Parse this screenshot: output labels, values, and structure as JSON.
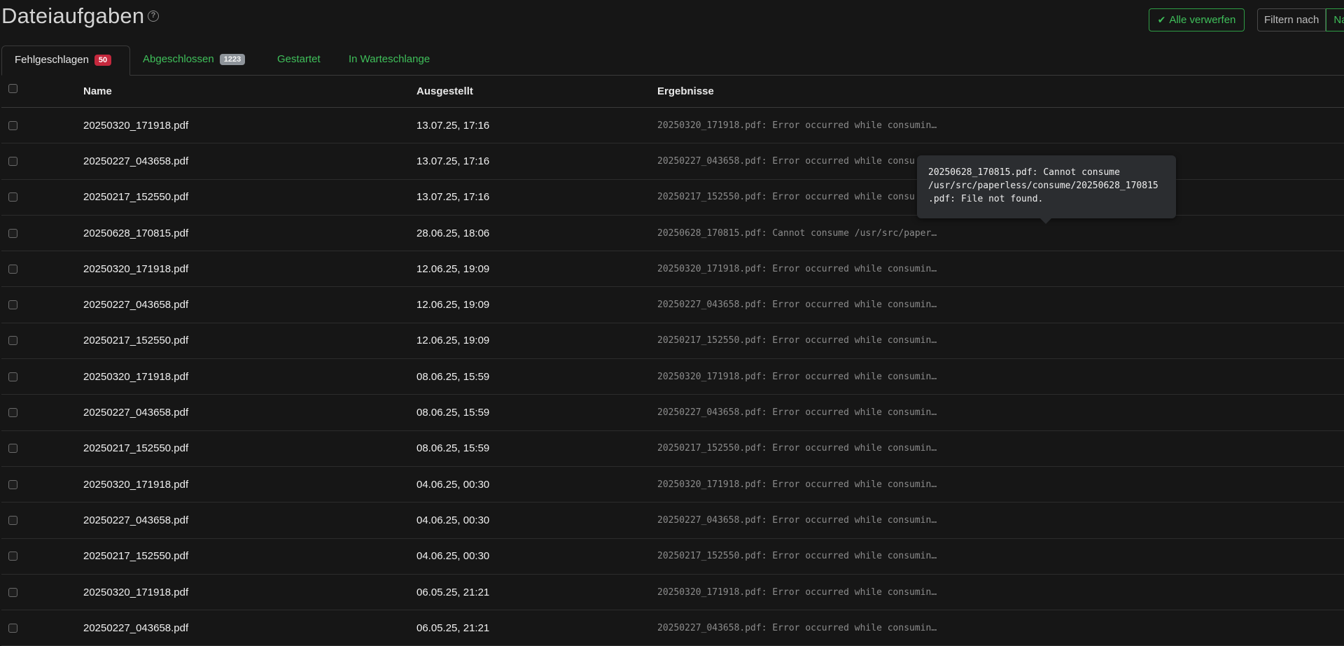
{
  "header": {
    "title": "Dateiaufgaben",
    "help_icon": "question-circle-icon",
    "discard_all_label": "Alle verwerfen",
    "discard_icon": "double-check-icon",
    "filter_label": "Filtern nach",
    "filter_field": "Na"
  },
  "tabs": [
    {
      "label": "Fehlgeschlagen",
      "badge": "50",
      "active": true
    },
    {
      "label": "Abgeschlossen",
      "badge": "1223",
      "active": false
    },
    {
      "label": "Gestartet",
      "active": false
    },
    {
      "label": "In Warteschlange",
      "active": false
    }
  ],
  "table": {
    "columns": {
      "name": "Name",
      "issued": "Ausgestellt",
      "results": "Ergebnisse"
    },
    "rows": [
      {
        "name": "20250320_171918.pdf",
        "issued": "13.07.25, 17:16",
        "result": "20250320_171918.pdf: Error occurred while consumin…"
      },
      {
        "name": "20250227_043658.pdf",
        "issued": "13.07.25, 17:16",
        "result": "20250227_043658.pdf: Error occurred while consu"
      },
      {
        "name": "20250217_152550.pdf",
        "issued": "13.07.25, 17:16",
        "result": "20250217_152550.pdf: Error occurred while consu"
      },
      {
        "name": "20250628_170815.pdf",
        "issued": "28.06.25, 18:06",
        "result": "20250628_170815.pdf: Cannot consume /usr/src/paper…"
      },
      {
        "name": "20250320_171918.pdf",
        "issued": "12.06.25, 19:09",
        "result": "20250320_171918.pdf: Error occurred while consumin…"
      },
      {
        "name": "20250227_043658.pdf",
        "issued": "12.06.25, 19:09",
        "result": "20250227_043658.pdf: Error occurred while consumin…"
      },
      {
        "name": "20250217_152550.pdf",
        "issued": "12.06.25, 19:09",
        "result": "20250217_152550.pdf: Error occurred while consumin…"
      },
      {
        "name": "20250320_171918.pdf",
        "issued": "08.06.25, 15:59",
        "result": "20250320_171918.pdf: Error occurred while consumin…"
      },
      {
        "name": "20250227_043658.pdf",
        "issued": "08.06.25, 15:59",
        "result": "20250227_043658.pdf: Error occurred while consumin…"
      },
      {
        "name": "20250217_152550.pdf",
        "issued": "08.06.25, 15:59",
        "result": "20250217_152550.pdf: Error occurred while consumin…"
      },
      {
        "name": "20250320_171918.pdf",
        "issued": "04.06.25, 00:30",
        "result": "20250320_171918.pdf: Error occurred while consumin…"
      },
      {
        "name": "20250227_043658.pdf",
        "issued": "04.06.25, 00:30",
        "result": "20250227_043658.pdf: Error occurred while consumin…"
      },
      {
        "name": "20250217_152550.pdf",
        "issued": "04.06.25, 00:30",
        "result": "20250217_152550.pdf: Error occurred while consumin…"
      },
      {
        "name": "20250320_171918.pdf",
        "issued": "06.05.25, 21:21",
        "result": "20250320_171918.pdf: Error occurred while consumin…"
      },
      {
        "name": "20250227_043658.pdf",
        "issued": "06.05.25, 21:21",
        "result": "20250227_043658.pdf: Error occurred while consumin…"
      }
    ]
  },
  "tooltip": {
    "text": "20250628_170815.pdf: Cannot consume\n/usr/src/paperless/consume/20250628_170815\n.pdf: File not found."
  },
  "colors": {
    "background": "#161616",
    "accent_green": "#3fbf5a",
    "badge_red": "#c5283d",
    "badge_gray": "#8e949a",
    "tooltip_bg": "#2b2d30"
  }
}
